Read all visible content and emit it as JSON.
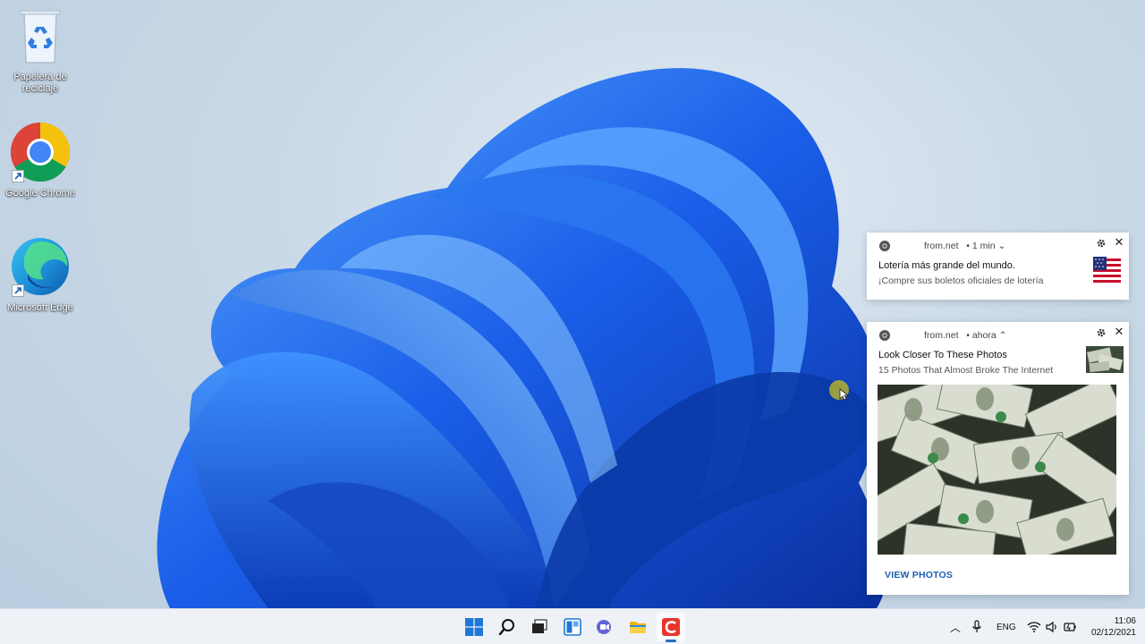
{
  "desktop": {
    "icons": [
      {
        "label": "Papelera de reciclaje",
        "icon": "recycle-bin-icon"
      },
      {
        "label": "Google Chrome",
        "icon": "chrome-icon"
      },
      {
        "label": "Microsoft Edge",
        "icon": "edge-icon"
      }
    ]
  },
  "notifications": [
    {
      "source": "from.net",
      "time": "1 min",
      "title": "Lotería más grande del mundo.",
      "body": "¡Compre sus boletos oficiales de lotería",
      "thumbnail": "us-flag-image"
    },
    {
      "source": "from.net",
      "time": "ahora",
      "title": "Look Closer To These Photos",
      "body": "15 Photos That Almost Broke The Internet",
      "thumbnail": "money-thumbnail",
      "image": "dollar-bills-image",
      "action": "VIEW PHOTOS"
    }
  ],
  "taskbar": {
    "apps": [
      "start-icon",
      "search-icon",
      "task-view-icon",
      "widgets-icon",
      "chat-icon",
      "file-explorer-icon",
      "app-c-icon"
    ],
    "tray": {
      "language": "ENG",
      "time": "11:06",
      "date": "02/12/2021"
    }
  },
  "colors": {
    "accent": "#1a5fb4",
    "bloom": "#1e5fe0",
    "taskbar": "#eef2f7"
  }
}
